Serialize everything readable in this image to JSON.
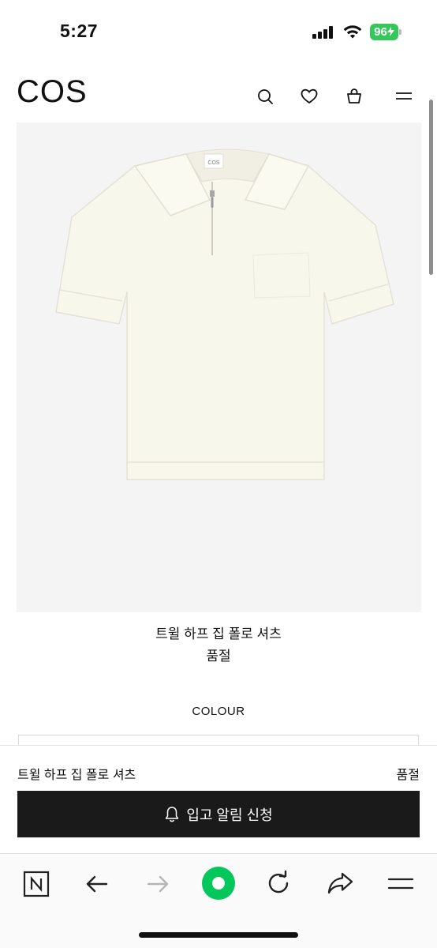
{
  "status_bar": {
    "time": "5:27",
    "battery_level": "96",
    "battery_color": "#34c759"
  },
  "header": {
    "logo": "COS",
    "icons": [
      "search-icon",
      "heart-icon",
      "bag-icon",
      "menu-icon"
    ]
  },
  "product": {
    "name": "트윌 하프 집 폴로 셔츠",
    "status": "품절",
    "colour_label": "COLOUR",
    "image_subject": "white-half-zip-polo-shirt",
    "garment_tag_text": "COS"
  },
  "sticky_bar": {
    "name": "트윌 하프 집 폴로 셔츠",
    "status": "품절",
    "notify_label": "입고 알림 신청",
    "button_color": "#1a1a1a"
  },
  "browser_toolbar": {
    "icons": [
      "naver-n-icon",
      "back-arrow-icon",
      "forward-arrow-icon",
      "green-dot-icon",
      "refresh-icon",
      "share-icon",
      "menu-icon"
    ],
    "accent_color": "#03c75a"
  }
}
